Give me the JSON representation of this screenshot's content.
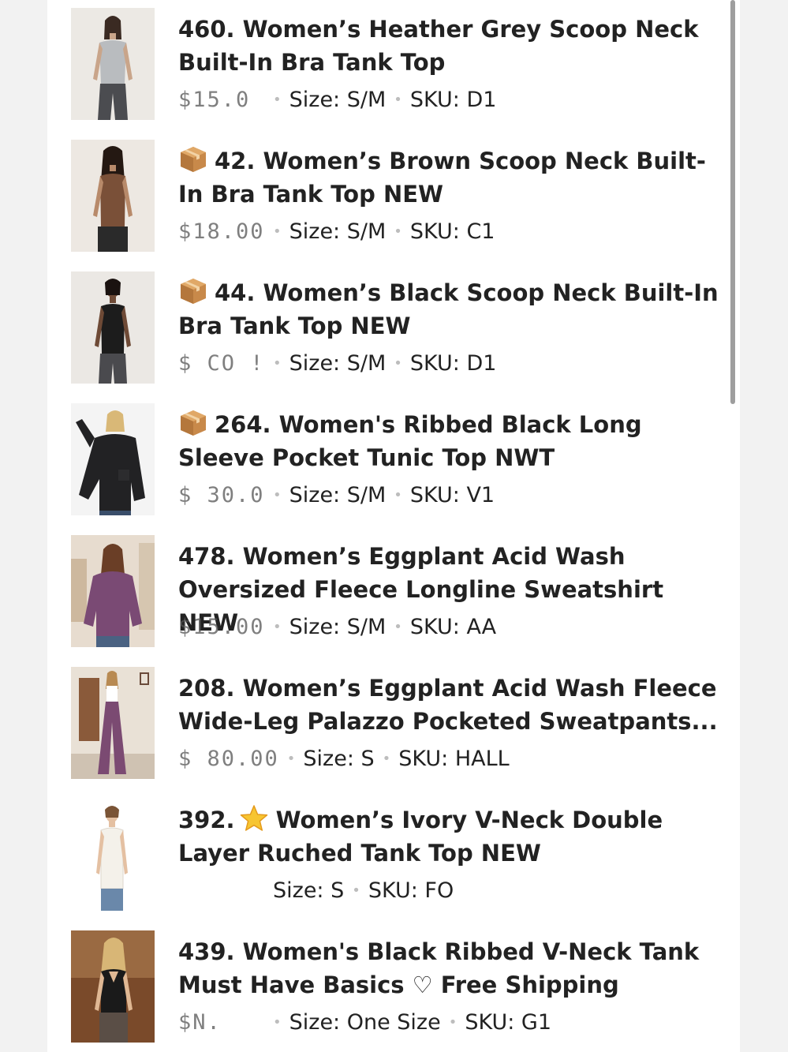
{
  "listings": [
    {
      "title": "460. Women’s Heather Grey Scoop Neck Built-In Bra Tank Top",
      "price": "$15.0",
      "size": "Size: S/M",
      "sku": "SKU: D1",
      "badge": ""
    },
    {
      "title": "42. Women’s Brown Scoop Neck Built-In Bra Tank Top NEW",
      "price": "$18.00",
      "size": "Size: S/M",
      "sku": "SKU: C1",
      "badge": "package-icon"
    },
    {
      "title": "44. Women’s Black Scoop Neck Built-In Bra Tank Top NEW",
      "price": "$ CO !",
      "size": "Size: S/M",
      "sku": "SKU: D1",
      "badge": "package-icon"
    },
    {
      "title": "264. Women's Ribbed Black Long Sleeve Pocket Tunic Top NWT",
      "price": "$ 30.0",
      "size": "Size: S/M",
      "sku": "SKU: V1",
      "badge": "package-icon"
    },
    {
      "title": "478. Women’s Eggplant Acid Wash Oversized Fleece Longline Sweatshirt NEW",
      "price": "$15.00",
      "size": "Size: S/M",
      "sku": "SKU: AA",
      "badge": ""
    },
    {
      "title": "208. Women’s Eggplant Acid Wash Fleece Wide-Leg Palazzo Pocketed Sweatpants...",
      "price": "$ 80.00",
      "size": "Size: S",
      "sku": "SKU: HALL",
      "badge": ""
    },
    {
      "title_prefix": "392.",
      "title": "Women’s Ivory V-Neck Double Layer Ruched Tank Top NEW",
      "price": "",
      "size": "Size: S",
      "sku": "SKU: FO",
      "badge": "star-icon"
    },
    {
      "title": "439. Women's Black Ribbed V-Neck Tank Must Have Basics ♡ Free Shipping",
      "price": "$N.",
      "size": "Size: One Size",
      "sku": "SKU: G1",
      "badge": ""
    }
  ],
  "colors": {
    "text": "#222222",
    "background": "#ffffff",
    "scrollbar": "#9e9e9e"
  }
}
